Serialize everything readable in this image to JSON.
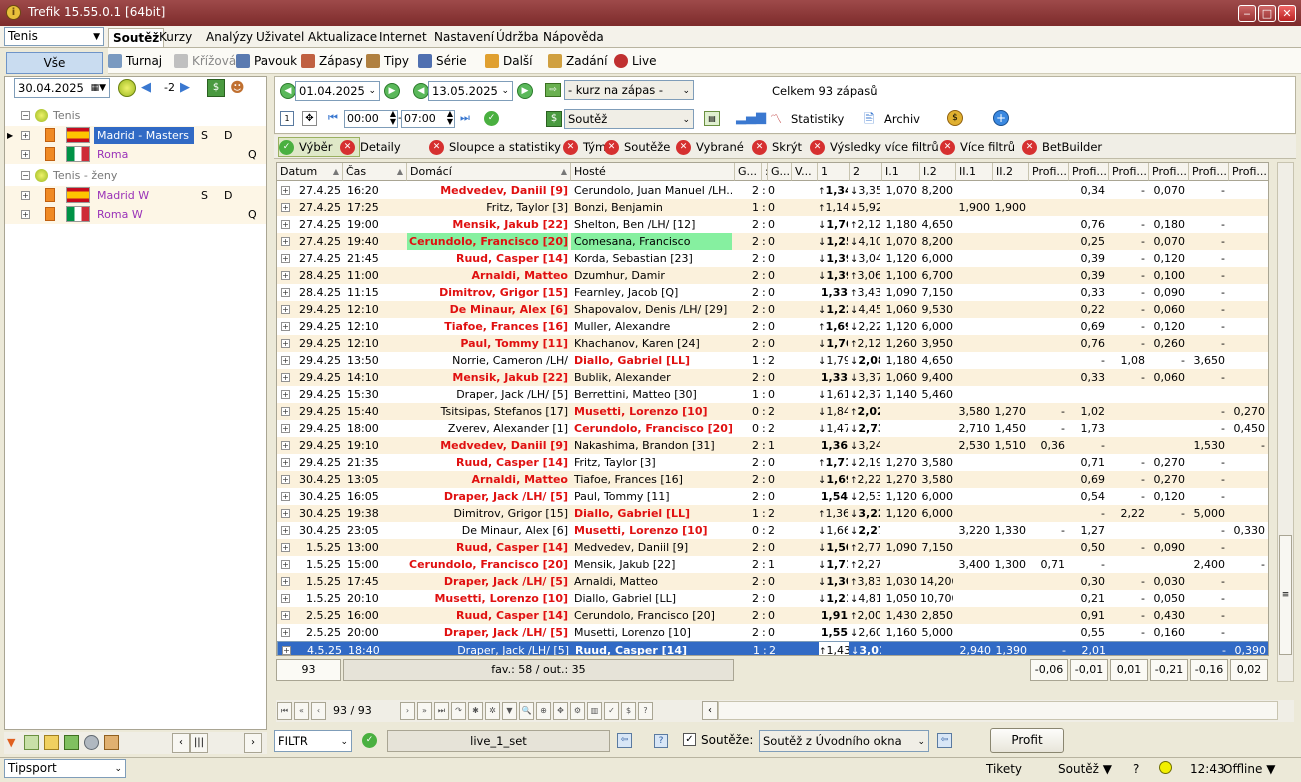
{
  "window": {
    "title": "Trefik 15.55.0.1 [64bit]"
  },
  "sport_select": "Tenis",
  "menu": [
    "Soutěž",
    "Kurzy",
    "Analýzy",
    "Uživatel",
    "Aktualizace",
    "Internet",
    "Nastavení",
    "Údržba",
    "Nápověda"
  ],
  "submenu": {
    "vse": "Vše",
    "items": [
      "Turnaj",
      "Křížová",
      "Pavouk",
      "Zápasy",
      "Tipy",
      "Série",
      "Další",
      "Zadání",
      "Live"
    ]
  },
  "left": {
    "date": "30.04.2025",
    "offset": "-2",
    "groups": [
      {
        "label": "Tenis",
        "rows": [
          {
            "name": "Madrid - Masters",
            "s": "S",
            "d": "D",
            "q": "",
            "flag": "es",
            "selected": true
          },
          {
            "name": "Roma",
            "s": "",
            "d": "",
            "q": "Q",
            "flag": "it",
            "selected": false
          }
        ]
      },
      {
        "label": "Tenis - ženy",
        "rows": [
          {
            "name": "Madrid W",
            "s": "S",
            "d": "D",
            "q": "",
            "flag": "es",
            "selected": false
          },
          {
            "name": "Roma W",
            "s": "",
            "d": "",
            "q": "Q",
            "flag": "it",
            "selected": false
          }
        ]
      }
    ]
  },
  "top": {
    "date_from": "01.04.2025",
    "date_to": "13.05.2025",
    "kurz_select": "- kurz na zápas -",
    "summary": "Celkem 93 zápasů",
    "soutez_select": "Soutěž",
    "time_from": "00:00",
    "time_to": "07:00",
    "statistiky": "Statistiky",
    "archiv": "Archiv"
  },
  "filters": [
    "Výběr",
    "Detaily",
    "Sloupce a statistiky",
    "Týmy",
    "Soutěže",
    "Vybrané",
    "Skrýt",
    "Výsledky více filtrů",
    "Více filtrů",
    "BetBuilder"
  ],
  "columns": [
    "Datum",
    "Čas",
    "Domácí",
    "Hosté",
    "G...",
    ":",
    "G...",
    "V...",
    "1",
    "2",
    "I.1",
    "I.2",
    "II.1",
    "II.2",
    "Profi...",
    "Profi...",
    "Profi...",
    "Profi...",
    "Profi...",
    "Profi..."
  ],
  "rows": [
    {
      "d": "27.4.25",
      "t": "16:20",
      "h": "Medvedev, Daniil [9]",
      "a": "Cerundolo, Juan Manuel /LH...",
      "hf": true,
      "af": false,
      "g1": "2",
      "g2": "0",
      "ar1": "up",
      "o1": "1,34",
      "ar2": "dn",
      "o2": "3,35",
      "i1": "1,070",
      "i2": "8,200",
      "ii1": "",
      "ii2": "",
      "p": [
        "",
        "0,34",
        "-",
        "0,070",
        "-",
        ""
      ]
    },
    {
      "d": "27.4.25",
      "t": "17:25",
      "h": "Fritz, Taylor [3]",
      "a": "Bonzi, Benjamin",
      "hf": false,
      "af": false,
      "g1": "1",
      "g2": "0",
      "ar1": "up",
      "o1": "1,14",
      "ar2": "dn",
      "o2": "5,92",
      "i1": "",
      "i2": "",
      "ii1": "1,900",
      "ii2": "1,900",
      "p": [
        "",
        "",
        "",
        "",
        "",
        ""
      ]
    },
    {
      "d": "27.4.25",
      "t": "19:00",
      "h": "Mensik, Jakub [22]",
      "a": "Shelton, Ben /LH/ [12]",
      "hf": true,
      "af": false,
      "g1": "2",
      "g2": "0",
      "ar1": "dn",
      "o1": "1,76",
      "ar2": "up",
      "o2": "2,12",
      "i1": "1,180",
      "i2": "4,650",
      "ii1": "",
      "ii2": "",
      "p": [
        "",
        "0,76",
        "-",
        "0,180",
        "-",
        ""
      ]
    },
    {
      "d": "27.4.25",
      "t": "19:40",
      "h": "Cerundolo, Francisco [20]",
      "a": "Comesana, Francisco",
      "hf": true,
      "af": false,
      "hl": true,
      "g1": "2",
      "g2": "0",
      "ar1": "dn",
      "o1": "1,25",
      "ar2": "dn",
      "o2": "4,10",
      "i1": "1,070",
      "i2": "8,200",
      "ii1": "",
      "ii2": "",
      "p": [
        "",
        "0,25",
        "-",
        "0,070",
        "-",
        ""
      ]
    },
    {
      "d": "27.4.25",
      "t": "21:45",
      "h": "Ruud, Casper [14]",
      "a": "Korda, Sebastian [23]",
      "hf": true,
      "af": false,
      "g1": "2",
      "g2": "0",
      "ar1": "dn",
      "o1": "1,39",
      "ar2": "dn",
      "o2": "3,04",
      "i1": "1,120",
      "i2": "6,000",
      "ii1": "",
      "ii2": "",
      "p": [
        "",
        "0,39",
        "-",
        "0,120",
        "-",
        ""
      ]
    },
    {
      "d": "28.4.25",
      "t": "11:00",
      "h": "Arnaldi, Matteo",
      "a": "Dzumhur, Damir",
      "hf": true,
      "af": false,
      "g1": "2",
      "g2": "0",
      "ar1": "dn",
      "o1": "1,39",
      "ar2": "up",
      "o2": "3,06",
      "i1": "1,100",
      "i2": "6,700",
      "ii1": "",
      "ii2": "",
      "p": [
        "",
        "0,39",
        "-",
        "0,100",
        "-",
        ""
      ]
    },
    {
      "d": "28.4.25",
      "t": "11:15",
      "h": "Dimitrov, Grigor [15]",
      "a": "Fearnley, Jacob [Q]",
      "hf": true,
      "af": false,
      "g1": "2",
      "g2": "0",
      "ar1": "",
      "o1": "1,33",
      "ar2": "up",
      "o2": "3,43",
      "i1": "1,090",
      "i2": "7,150",
      "ii1": "",
      "ii2": "",
      "p": [
        "",
        "0,33",
        "-",
        "0,090",
        "-",
        ""
      ]
    },
    {
      "d": "29.4.25",
      "t": "12:10",
      "h": "De Minaur, Alex [6]",
      "a": "Shapovalov, Denis /LH/ [29]",
      "hf": true,
      "af": false,
      "g1": "2",
      "g2": "0",
      "ar1": "dn",
      "o1": "1,22",
      "ar2": "dn",
      "o2": "4,45",
      "i1": "1,060",
      "i2": "9,530",
      "ii1": "",
      "ii2": "",
      "p": [
        "",
        "0,22",
        "-",
        "0,060",
        "-",
        ""
      ]
    },
    {
      "d": "29.4.25",
      "t": "12:10",
      "h": "Tiafoe, Frances [16]",
      "a": "Muller, Alexandre",
      "hf": true,
      "af": false,
      "g1": "2",
      "g2": "0",
      "ar1": "up",
      "o1": "1,69",
      "ar2": "dn",
      "o2": "2,22",
      "i1": "1,120",
      "i2": "6,000",
      "ii1": "",
      "ii2": "",
      "p": [
        "",
        "0,69",
        "-",
        "0,120",
        "-",
        ""
      ]
    },
    {
      "d": "29.4.25",
      "t": "12:10",
      "h": "Paul, Tommy [11]",
      "a": "Khachanov, Karen [24]",
      "hf": true,
      "af": false,
      "g1": "2",
      "g2": "0",
      "ar1": "dn",
      "o1": "1,76",
      "ar2": "up",
      "o2": "2,12",
      "i1": "1,260",
      "i2": "3,950",
      "ii1": "",
      "ii2": "",
      "p": [
        "",
        "0,76",
        "-",
        "0,260",
        "-",
        ""
      ]
    },
    {
      "d": "29.4.25",
      "t": "13:50",
      "h": "Norrie, Cameron /LH/",
      "a": "Diallo, Gabriel [LL]",
      "hf": false,
      "af": true,
      "g1": "1",
      "g2": "2",
      "ar1": "dn",
      "o1": "1,79",
      "ar2": "dn",
      "o2": "2,08",
      "i1": "1,180",
      "i2": "4,650",
      "ii1": "",
      "ii2": "",
      "p": [
        "",
        "-",
        "1,08",
        "-",
        "3,650",
        ""
      ]
    },
    {
      "d": "29.4.25",
      "t": "14:10",
      "h": "Mensik, Jakub [22]",
      "a": "Bublik, Alexander",
      "hf": true,
      "af": false,
      "g1": "2",
      "g2": "0",
      "ar1": "",
      "o1": "1,33",
      "ar2": "dn",
      "o2": "3,37",
      "i1": "1,060",
      "i2": "9,400",
      "ii1": "",
      "ii2": "",
      "p": [
        "",
        "0,33",
        "-",
        "0,060",
        "-",
        ""
      ]
    },
    {
      "d": "29.4.25",
      "t": "15:30",
      "h": "Draper, Jack /LH/ [5]",
      "a": "Berrettini, Matteo [30]",
      "hf": false,
      "af": false,
      "g1": "1",
      "g2": "0",
      "ar1": "dn",
      "o1": "1,61",
      "ar2": "dn",
      "o2": "2,37",
      "i1": "1,140",
      "i2": "5,460",
      "ii1": "",
      "ii2": "",
      "p": [
        "",
        "",
        "",
        "",
        "",
        ""
      ]
    },
    {
      "d": "29.4.25",
      "t": "15:40",
      "h": "Tsitsipas, Stefanos [17]",
      "a": "Musetti, Lorenzo [10]",
      "hf": false,
      "af": true,
      "g1": "0",
      "g2": "2",
      "ar1": "dn",
      "o1": "1,84",
      "ar2": "up",
      "o2": "2,02",
      "i1": "",
      "i2": "",
      "ii1": "3,580",
      "ii2": "1,270",
      "p": [
        "",
        "-",
        "1,02",
        "",
        "",
        "-",
        "0,270"
      ]
    },
    {
      "d": "29.4.25",
      "t": "18:00",
      "h": "Zverev, Alexander [1]",
      "a": "Cerundolo, Francisco [20]",
      "hf": false,
      "af": true,
      "g1": "0",
      "g2": "2",
      "ar1": "dn",
      "o1": "1,47",
      "ar2": "dn",
      "o2": "2,73",
      "i1": "",
      "i2": "",
      "ii1": "2,710",
      "ii2": "1,450",
      "p": [
        "",
        "-",
        "1,73",
        "",
        "",
        "-",
        "0,450"
      ]
    },
    {
      "d": "29.4.25",
      "t": "19:10",
      "h": "Medvedev, Daniil [9]",
      "a": "Nakashima, Brandon [31]",
      "hf": true,
      "af": false,
      "g1": "2",
      "g2": "1",
      "ar1": "",
      "o1": "1,36",
      "ar2": "dn",
      "o2": "3,24",
      "i1": "",
      "i2": "",
      "ii1": "2,530",
      "ii2": "1,510",
      "p": [
        "0,36",
        "-",
        "",
        "",
        "1,530",
        "-"
      ]
    },
    {
      "d": "29.4.25",
      "t": "21:35",
      "h": "Ruud, Casper [14]",
      "a": "Fritz, Taylor [3]",
      "hf": true,
      "af": false,
      "g1": "2",
      "g2": "0",
      "ar1": "up",
      "o1": "1,71",
      "ar2": "dn",
      "o2": "2,19",
      "i1": "1,270",
      "i2": "3,580",
      "ii1": "",
      "ii2": "",
      "p": [
        "",
        "0,71",
        "-",
        "0,270",
        "-",
        ""
      ]
    },
    {
      "d": "30.4.25",
      "t": "13:05",
      "h": "Arnaldi, Matteo",
      "a": "Tiafoe, Frances [16]",
      "hf": true,
      "af": false,
      "g1": "2",
      "g2": "0",
      "ar1": "dn",
      "o1": "1,69",
      "ar2": "up",
      "o2": "2,22",
      "i1": "1,270",
      "i2": "3,580",
      "ii1": "",
      "ii2": "",
      "p": [
        "",
        "0,69",
        "-",
        "0,270",
        "-",
        ""
      ]
    },
    {
      "d": "30.4.25",
      "t": "16:05",
      "h": "Draper, Jack /LH/ [5]",
      "a": "Paul, Tommy [11]",
      "hf": true,
      "af": false,
      "g1": "2",
      "g2": "0",
      "ar1": "",
      "o1": "1,54",
      "ar2": "dn",
      "o2": "2,53",
      "i1": "1,120",
      "i2": "6,000",
      "ii1": "",
      "ii2": "",
      "p": [
        "",
        "0,54",
        "-",
        "0,120",
        "-",
        ""
      ]
    },
    {
      "d": "30.4.25",
      "t": "19:38",
      "h": "Dimitrov, Grigor [15]",
      "a": "Diallo, Gabriel [LL]",
      "hf": false,
      "af": true,
      "g1": "1",
      "g2": "2",
      "ar1": "up",
      "o1": "1,36",
      "ar2": "dn",
      "o2": "3,22",
      "i1": "1,120",
      "i2": "6,000",
      "ii1": "",
      "ii2": "",
      "p": [
        "",
        "-",
        "2,22",
        "-",
        "5,000",
        ""
      ]
    },
    {
      "d": "30.4.25",
      "t": "23:05",
      "h": "De Minaur, Alex [6]",
      "a": "Musetti, Lorenzo [10]",
      "hf": false,
      "af": true,
      "g1": "0",
      "g2": "2",
      "ar1": "dn",
      "o1": "1,66",
      "ar2": "dn",
      "o2": "2,27",
      "i1": "",
      "i2": "",
      "ii1": "3,220",
      "ii2": "1,330",
      "p": [
        "",
        "-",
        "1,27",
        "",
        "",
        "-",
        "0,330"
      ]
    },
    {
      "d": "1.5.25",
      "t": "13:00",
      "h": "Ruud, Casper [14]",
      "a": "Medvedev, Daniil [9]",
      "hf": true,
      "af": false,
      "g1": "2",
      "g2": "0",
      "ar1": "dn",
      "o1": "1,50",
      "ar2": "up",
      "o2": "2,77",
      "i1": "1,090",
      "i2": "7,150",
      "ii1": "",
      "ii2": "",
      "p": [
        "",
        "0,50",
        "-",
        "0,090",
        "-",
        ""
      ]
    },
    {
      "d": "1.5.25",
      "t": "15:00",
      "h": "Cerundolo, Francisco [20]",
      "a": "Mensik, Jakub [22]",
      "hf": true,
      "af": false,
      "g1": "2",
      "g2": "1",
      "ar1": "dn",
      "o1": "1,71",
      "ar2": "up",
      "o2": "2,27",
      "i1": "",
      "i2": "",
      "ii1": "3,400",
      "ii2": "1,300",
      "p": [
        "0,71",
        "-",
        "",
        "",
        "2,400",
        "-"
      ]
    },
    {
      "d": "1.5.25",
      "t": "17:45",
      "h": "Draper, Jack /LH/ [5]",
      "a": "Arnaldi, Matteo",
      "hf": true,
      "af": false,
      "g1": "2",
      "g2": "0",
      "ar1": "dn",
      "o1": "1,30",
      "ar2": "up",
      "o2": "3,83",
      "i1": "1,030",
      "i2": "14,200",
      "ii1": "",
      "ii2": "",
      "p": [
        "",
        "0,30",
        "-",
        "0,030",
        "-",
        ""
      ]
    },
    {
      "d": "1.5.25",
      "t": "20:10",
      "h": "Musetti, Lorenzo [10]",
      "a": "Diallo, Gabriel [LL]",
      "hf": true,
      "af": false,
      "g1": "2",
      "g2": "0",
      "ar1": "dn",
      "o1": "1,21",
      "ar2": "dn",
      "o2": "4,81",
      "i1": "1,050",
      "i2": "10,700",
      "ii1": "",
      "ii2": "",
      "p": [
        "",
        "0,21",
        "-",
        "0,050",
        "-",
        ""
      ]
    },
    {
      "d": "2.5.25",
      "t": "16:00",
      "h": "Ruud, Casper [14]",
      "a": "Cerundolo, Francisco [20]",
      "hf": true,
      "af": false,
      "g1": "2",
      "g2": "0",
      "ar1": "",
      "o1": "1,91",
      "ar2": "up",
      "o2": "2,00",
      "i1": "1,430",
      "i2": "2,850",
      "ii1": "",
      "ii2": "",
      "p": [
        "",
        "0,91",
        "-",
        "0,430",
        "-",
        ""
      ]
    },
    {
      "d": "2.5.25",
      "t": "20:00",
      "h": "Draper, Jack /LH/ [5]",
      "a": "Musetti, Lorenzo [10]",
      "hf": true,
      "af": false,
      "g1": "2",
      "g2": "0",
      "ar1": "",
      "o1": "1,55",
      "ar2": "dn",
      "o2": "2,60",
      "i1": "1,160",
      "i2": "5,000",
      "ii1": "",
      "ii2": "",
      "p": [
        "",
        "0,55",
        "-",
        "0,160",
        "-",
        ""
      ]
    },
    {
      "d": "4.5.25",
      "t": "18:40",
      "h": "Draper, Jack /LH/ [5]",
      "a": "Ruud, Casper [14]",
      "hf": false,
      "af": true,
      "sel": true,
      "g1": "1",
      "g2": "2",
      "ar1": "up",
      "o1": "1,43",
      "ar2": "dn",
      "o2": "3,01",
      "i1": "",
      "i2": "",
      "ii1": "2,940",
      "ii2": "1,390",
      "p": [
        "",
        "-",
        "2,01",
        "",
        "",
        "-",
        "0,390"
      ]
    }
  ],
  "footer": {
    "count": "93",
    "favout": "fav.: 58 / out.: 35",
    "profits": [
      "-0,06",
      "-0,01",
      "0,01",
      "-0,21",
      "-0,16",
      "0,02"
    ]
  },
  "nav": {
    "pos": "93 / 93"
  },
  "bottom": {
    "filtr": "FILTR",
    "live_set": "live_1_set",
    "soutez_label": "Soutěže:",
    "soutez_value": "Soutěž z Úvodního okna",
    "profit_button": "Profit"
  },
  "status": {
    "tipsport": "Tipsport",
    "tikety": "Tikety",
    "soutez": "Soutěž",
    "question": "?",
    "time": "12:43",
    "offline": "Offline"
  },
  "colors": {
    "favorite": "#e01010",
    "selected_row": "#316ac5",
    "alt_row": "#fbf1dc",
    "highlight": "#86f0a0"
  }
}
